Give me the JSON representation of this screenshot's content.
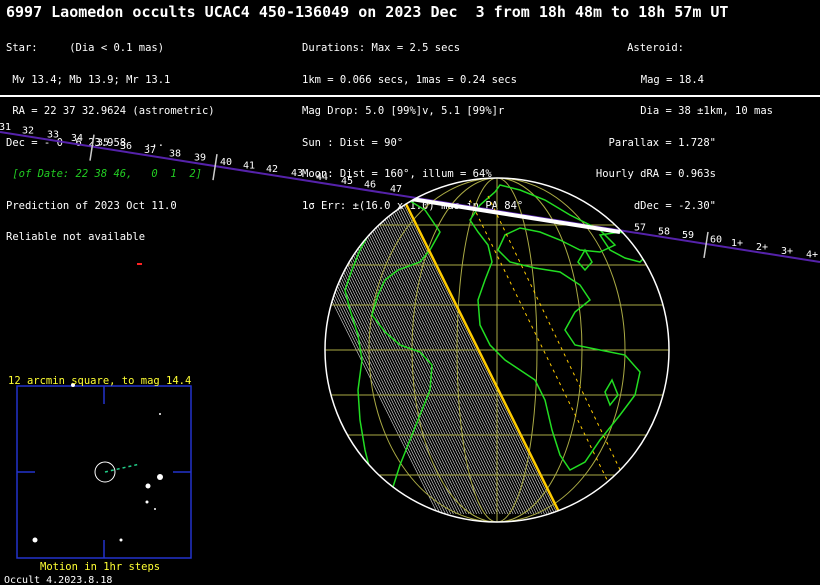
{
  "title": "6997 Laomedon occults UCAC4 450-136049 on 2023 Dec  3 from 18h 48m to 18h 57m UT",
  "star": {
    "header": "Star:     (Dia < 0.1 mas)",
    "mags": " Mv 13.4; Mb 13.9; Mr 13.1",
    "ra": " RA = 22 37 32.9624 (astrometric)",
    "dec": "Dec = - 0  6 23.958   ...",
    "of_date": " [of Date: 22 38 46,   0  1  2]",
    "prediction": "Prediction of 2023 Oct 11.0",
    "reliable": "Reliable not available"
  },
  "event": {
    "durations": "Durations: Max = 2.5 secs",
    "scale": "1km = 0.066 secs, 1mas = 0.24 secs",
    "mag_drop": "Mag Drop: 5.0 [99%]v, 5.1 [99%]r",
    "sun": "Sun : Dist = 90°",
    "moon": "Moon: Dist = 160°, illum = 64%",
    "err": "1σ Err: ±(16.0 x 1.0) mas in PA 84°"
  },
  "asteroid": {
    "header": "Asteroid:",
    "mag": "Mag = 18.4",
    "dia": "Dia = 38 ±1km, 10 mas",
    "parallax": "Parallax = 1.728\"",
    "dra": "Hourly dRA = 0.963s",
    "ddec": "dDec = -2.30\""
  },
  "track_labels": [
    "31",
    "32",
    "33",
    "34",
    "35",
    "36",
    "37",
    "38",
    "39",
    "40",
    "41",
    "42",
    "43",
    "44",
    "45",
    "46",
    "47",
    "57",
    "58",
    "59",
    "60",
    "1+",
    "2+",
    "3+",
    "4+"
  ],
  "finder": {
    "title": "12 arcmin square, to mag 14.4",
    "footer": "Motion in 1hr steps"
  },
  "version": "Occult 4.2023.8.18",
  "colors": {
    "track": "#5522aa",
    "globe_outline": "#ffffff",
    "coast": "#22dd22",
    "center_line": "#ffcc00",
    "grid": "#aaaa44",
    "path_edge": "#ffffff",
    "caption": "#ffff33",
    "finder_frame": "#2233cc"
  }
}
